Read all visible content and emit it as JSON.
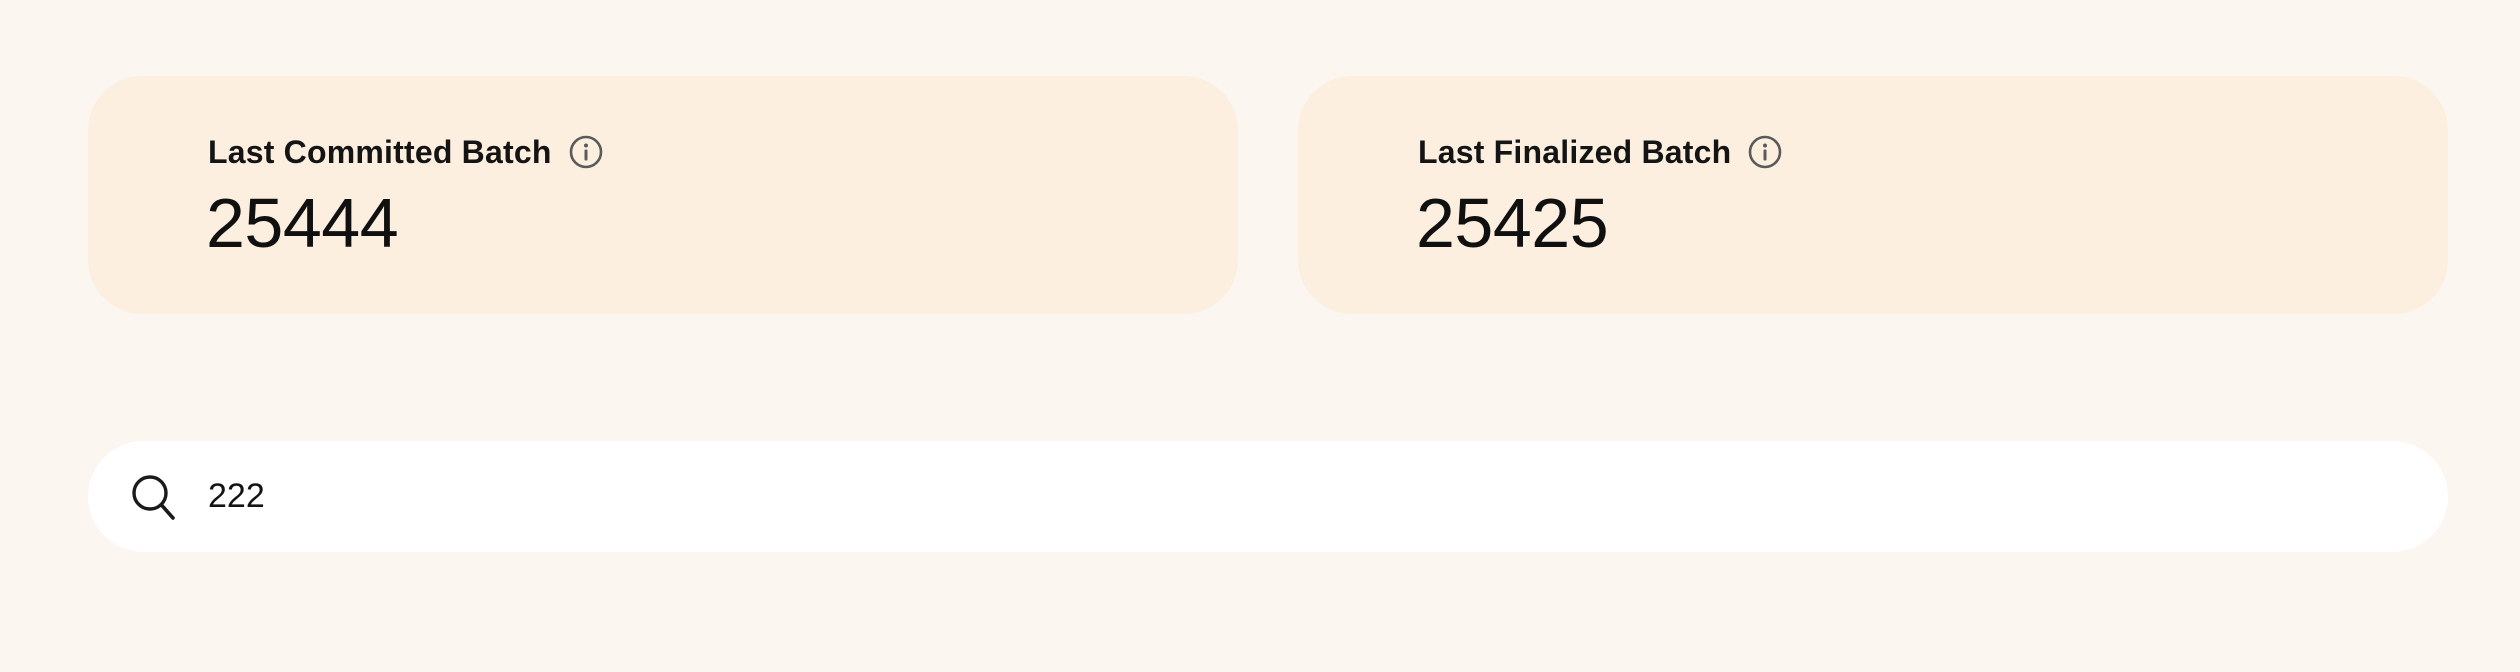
{
  "stats": {
    "committed": {
      "label": "Last Committed Batch",
      "value": "25444",
      "icon": "info-icon"
    },
    "finalized": {
      "label": "Last Finalized Batch",
      "value": "25425",
      "icon": "info-icon"
    }
  },
  "search": {
    "value": "222",
    "icon": "search-icon"
  },
  "colors": {
    "page_background": "#fcf6f1",
    "card_background": "#fcefdf",
    "search_background": "#ffffff",
    "text": "#141414",
    "icon_stroke": "#5a5a5a"
  }
}
